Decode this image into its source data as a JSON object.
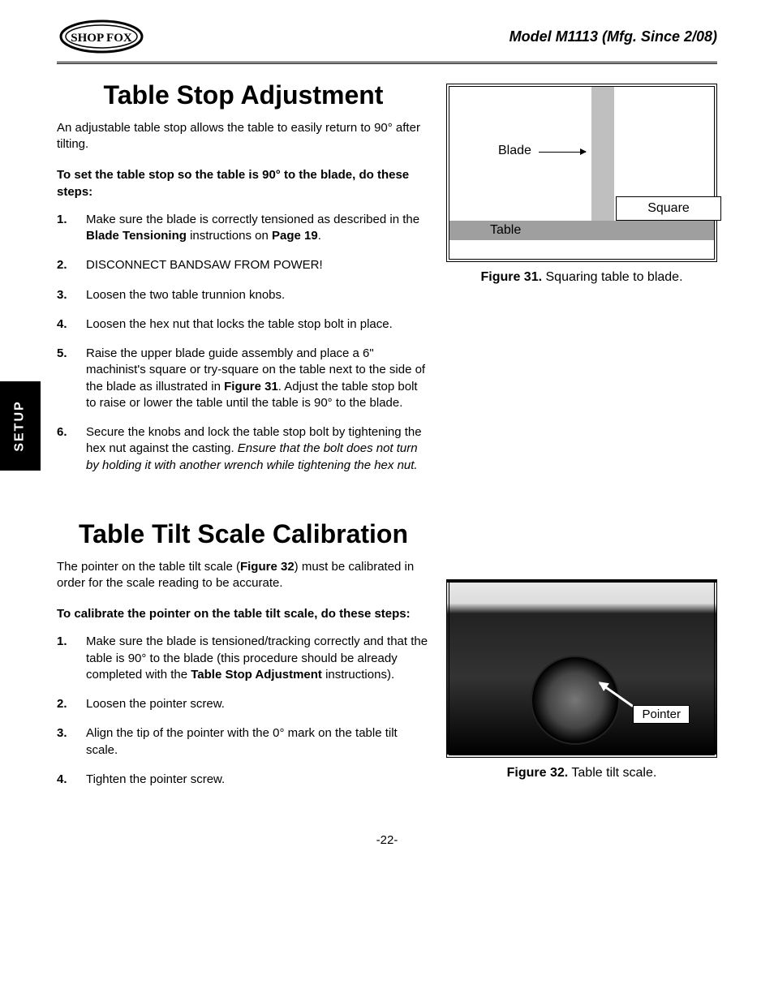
{
  "header": {
    "logo_text": "SHOP FOX",
    "model": "Model M1113 (Mfg. Since 2/08)"
  },
  "side_tab": "SETUP",
  "section1": {
    "title": "Table Stop Adjustment",
    "intro": "An adjustable table stop allows the table to easily return to 90° after tilting.",
    "lead": "To set the table stop so the table is 90° to the blade, do these steps:",
    "steps": {
      "s1a": "Make sure the blade is correctly tensioned as described in the ",
      "s1b": "Blade Tensioning",
      "s1c": " instructions on ",
      "s1d": "Page 19",
      "s1e": ".",
      "s2": "DISCONNECT BANDSAW FROM POWER!",
      "s3": "Loosen the two table trunnion knobs.",
      "s4": "Loosen the hex nut that locks the table stop bolt in place.",
      "s5a": "Raise the upper blade guide assembly and place a 6\" machinist's square or try-square on the table next to the side of the blade as illustrated in ",
      "s5b": "Figure 31",
      "s5c": ". Adjust the table stop bolt to raise or lower the table until the table is 90° to the blade.",
      "s6a": "Secure the knobs and lock the table stop bolt by tightening the hex nut against the casting. ",
      "s6b": "Ensure that the bolt does not turn by holding it with another wrench while tightening the hex nut."
    },
    "figure": {
      "blade": "Blade",
      "table": "Table",
      "square": "Square",
      "caption_b": "Figure 31.",
      "caption": " Squaring table to blade."
    }
  },
  "section2": {
    "title": "Table Tilt Scale Calibration",
    "intro_a": "The pointer on the table tilt scale (",
    "intro_b": "Figure 32",
    "intro_c": ") must be calibrated in order for the scale reading to be accurate.",
    "lead": "To calibrate the pointer on the table tilt scale, do these steps:",
    "steps": {
      "s1a": "Make sure the blade is tensioned/tracking correctly and that the table is 90° to the blade (this procedure should be already completed with the ",
      "s1b": "Table Stop Adjustment",
      "s1c": " instructions).",
      "s2": "Loosen the pointer screw.",
      "s3": "Align the tip of the pointer with the 0° mark on the table tilt scale.",
      "s4": "Tighten the pointer screw."
    },
    "figure": {
      "pointer": "Pointer",
      "caption_b": "Figure 32.",
      "caption": " Table tilt scale."
    }
  },
  "page_number": "-22-"
}
